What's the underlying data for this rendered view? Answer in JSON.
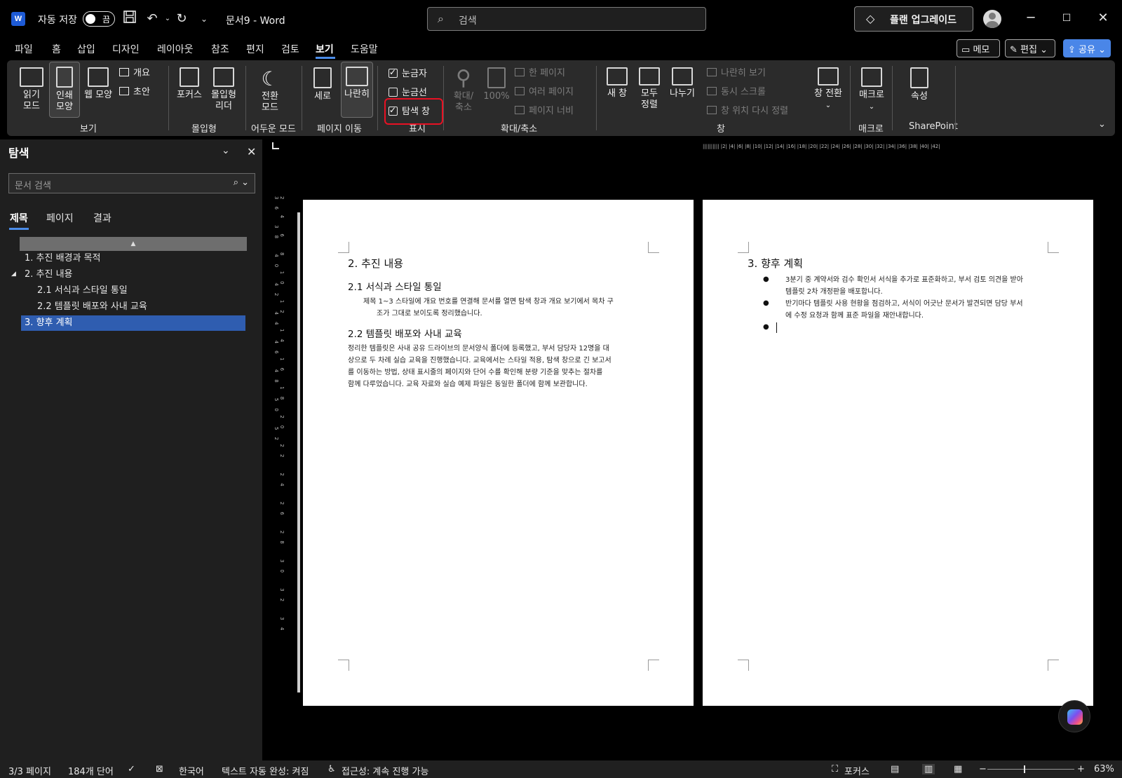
{
  "titlebar": {
    "autosave_label": "자동 저장",
    "autosave_state": "끔",
    "doc_title": "문서9 - Word",
    "search_placeholder": "검색",
    "upgrade_label": "플랜 업그레이드"
  },
  "menu": {
    "tabs": [
      "파일",
      "홈",
      "삽입",
      "디자인",
      "레이아웃",
      "참조",
      "편지",
      "검토",
      "보기",
      "도움말"
    ],
    "active_tab": "보기",
    "memo": "메모",
    "edit": "편집",
    "share": "공유"
  },
  "ribbon": {
    "view_group": {
      "label": "보기",
      "read_mode": "읽기\n모드",
      "print_layout": "인쇄\n모양",
      "web_layout": "웹 모양",
      "outline": "개요",
      "draft": "초안"
    },
    "immersive_group": {
      "label": "몰입형",
      "focus": "포커스",
      "immersive_reader": "몰입형\n리더"
    },
    "dark_group": {
      "label": "어두운 모드",
      "switch_mode": "전환\n모드"
    },
    "page_move_group": {
      "label": "페이지 이동",
      "vertical": "세로",
      "side_by_side": "나란히"
    },
    "show_group": {
      "label": "표시",
      "ruler": "눈금자",
      "gridlines": "눈금선",
      "nav_pane": "탐색 창",
      "ruler_checked": true,
      "gridlines_checked": false,
      "nav_pane_checked": true
    },
    "zoom_group": {
      "label": "확대/축소",
      "zoom": "확대/\n축소",
      "hundred": "100%",
      "one_page": "한 페이지",
      "multi_page": "여러 페이지",
      "page_width": "페이지 너비"
    },
    "window_group": {
      "label": "창",
      "new_window": "새 창",
      "arrange_all": "모두\n정렬",
      "split": "나누기",
      "side_by_side": "나란히 보기",
      "sync_scroll": "동시 스크롤",
      "reset_pos": "창 위치 다시 정렬",
      "switch_window": "창 전환"
    },
    "macro_group": {
      "label": "매크로",
      "macro": "매크로"
    },
    "sharepoint_group": {
      "label": "SharePoint",
      "properties": "속성"
    }
  },
  "navpane": {
    "title": "탐색",
    "search_placeholder": "문서 검색",
    "tabs": [
      "제목",
      "페이지",
      "결과"
    ],
    "items": [
      {
        "label": "1. 추진 배경과 목적"
      },
      {
        "label": "2. 추진 내용"
      },
      {
        "label": "2.1 서식과 스타일 통일"
      },
      {
        "label": "2.2 템플릿 배포와 사내 교육"
      },
      {
        "label": "3. 향후 계획"
      }
    ]
  },
  "page1": {
    "h1": "2. 추진 내용",
    "h2a": "2.1 서식과 스타일 통일",
    "p1_line1": "제목 1~3 스타일에 개요 번호를 연결해 문서를 열면 탐색 창과 개요 보기에서 목차 구",
    "p1_line2": "조가 그대로 보이도록 정리했습니다.",
    "h2b": "2.2 템플릿 배포와 사내 교육",
    "p2_line1": "정리한 템플릿은 사내 공유 드라이브의 문서양식 폴더에 등록했고, 부서 담당자 12명을 대",
    "p2_line2": "상으로 두 차례 실습 교육을 진행했습니다. 교육에서는 스타일 적용, 탐색 창으로 긴 보고서",
    "p2_line3": "를 이동하는 방법, 상태 표시줄의 페이지와 단어 수를 확인해 분량 기준을 맞추는 절차를",
    "p2_line4": "함께 다루었습니다. 교육 자료와 실습 예제 파일은 동일한 폴더에 함께 보관합니다."
  },
  "page2": {
    "h1": "3. 향후 계획",
    "b1_line1": "3분기 중 계약서와 검수 확인서 서식을 추가로 표준화하고, 부서 검토 의견을 받아",
    "b1_line2": "템플릿 2차 개정판을 배포합니다.",
    "b2_line1": "반기마다 템플릿 사용 현황을 점검하고, 서식이 어긋난 문서가 발견되면 담당 부서",
    "b2_line2": "에 수정 요청과 함께 표준 파일을 재안내합니다."
  },
  "statusbar": {
    "page": "3/3 페이지",
    "words": "184개 단어",
    "language": "한국어",
    "autocomplete": "텍스트 자동 완성: 켜짐",
    "accessibility": "접근성: 계속 진행 가능",
    "focus": "포커스",
    "zoom": "63%"
  },
  "ruler_top": "|||||||||| |2| |4| |6| |8| |10| |12| |14| |16| |18| |20| |22| |24| |26| |28| |30| |32| |34| |36| |38| |40| |42|",
  "ruler_left": "2 4 6 8 10 12 14 16 18 20 22 24 26 28 30 32 34 36 38 40 42 44 46 48 50 52",
  "colors": {
    "accent": "#4b8ce8",
    "nav_selected": "#2f5db0",
    "highlight": "#e81123",
    "share": "#4a86e8"
  }
}
